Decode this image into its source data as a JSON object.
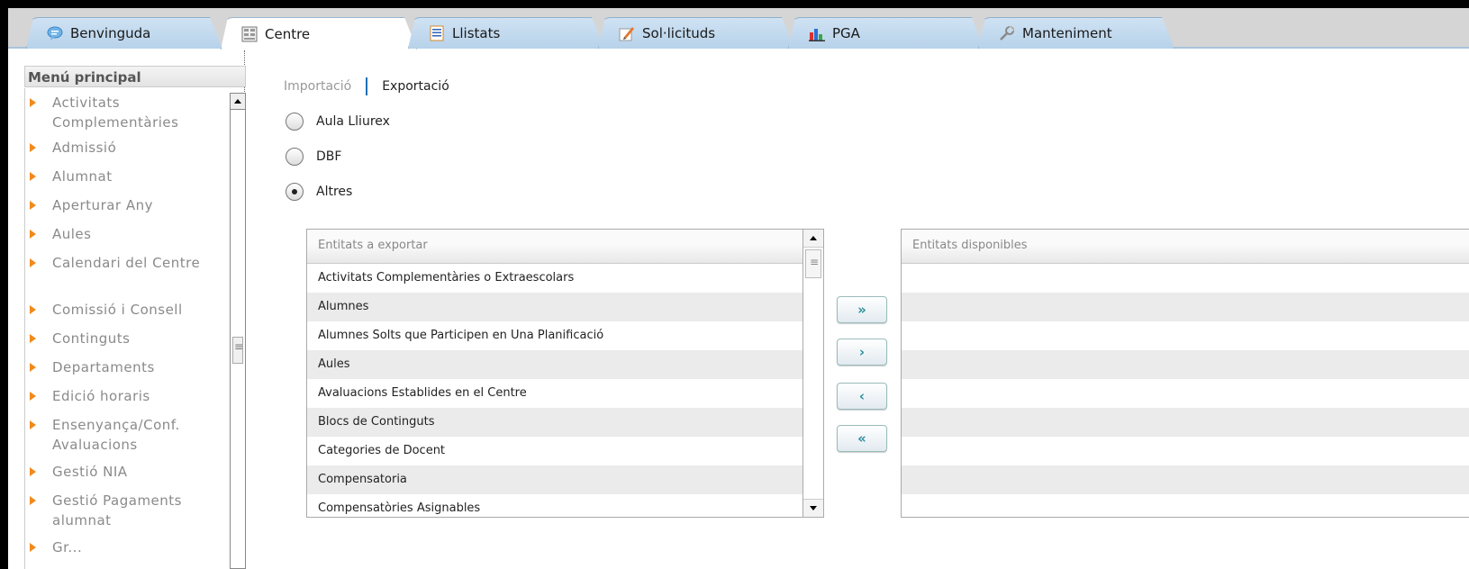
{
  "tabs": [
    {
      "label": "Benvinguda",
      "icon": "chat-bubble-icon",
      "active": false
    },
    {
      "label": "Centre",
      "icon": "building-grid-icon",
      "active": true
    },
    {
      "label": "Llistats",
      "icon": "list-document-icon",
      "active": false
    },
    {
      "label": "Sol·licituds",
      "icon": "pencil-form-icon",
      "active": false
    },
    {
      "label": "PGA",
      "icon": "bar-chart-icon",
      "active": false
    },
    {
      "label": "Manteniment",
      "icon": "wrench-icon",
      "active": false
    }
  ],
  "sidebar": {
    "title": "Menú principal",
    "items": [
      {
        "label": "Activitats Complementàries"
      },
      {
        "label": "Admissió"
      },
      {
        "label": "Alumnat"
      },
      {
        "label": "Aperturar Any"
      },
      {
        "label": "Aules"
      },
      {
        "label": "Calendari del Centre"
      },
      {
        "label": "Comissió i Consell"
      },
      {
        "label": "Continguts"
      },
      {
        "label": "Departaments"
      },
      {
        "label": "Edició horaris"
      },
      {
        "label": "Ensenyança/Conf. Avaluacions"
      },
      {
        "label": "Gestió NIA"
      },
      {
        "label": "Gestió Pagaments alumnat"
      },
      {
        "label": "Gr..."
      }
    ]
  },
  "subnav": {
    "import_label": "Importació",
    "export_label": "Exportació"
  },
  "radios": [
    {
      "label": "Aula Lliurex",
      "checked": false
    },
    {
      "label": "DBF",
      "checked": false
    },
    {
      "label": "Altres",
      "checked": true
    }
  ],
  "export_list": {
    "header": "Entitats a exportar",
    "rows": [
      "Activitats Complementàries o Extraescolars",
      "Alumnes",
      "Alumnes Solts que Participen en Una Planificació",
      "Aules",
      "Avaluacions Establides en el Centre",
      "Blocs de Continguts",
      "Categories de Docent",
      "Compensatoria",
      "Compensatòries Asignables"
    ]
  },
  "available_list": {
    "header": "Entitats disponibles",
    "rows": []
  },
  "move_buttons": {
    "add_all": "»",
    "add_one": "›",
    "remove_one": "‹",
    "remove_all": "«"
  },
  "colors": {
    "tab_bg": "#b7d2ea",
    "bullet": "#f08a1c",
    "separator": "#1f6fb5",
    "button_arrow": "#2a8f9a"
  }
}
